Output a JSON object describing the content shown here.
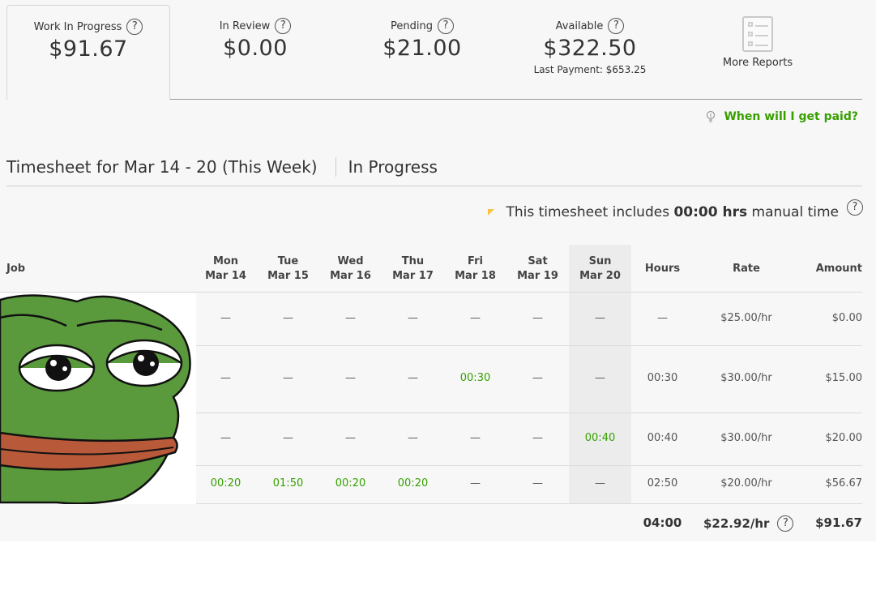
{
  "summary": {
    "work_in_progress": {
      "label": "Work In Progress",
      "amount": "$91.67"
    },
    "in_review": {
      "label": "In Review",
      "amount": "$0.00"
    },
    "pending": {
      "label": "Pending",
      "amount": "$21.00"
    },
    "available": {
      "label": "Available",
      "amount": "$322.50",
      "last_payment": "Last Payment: $653.25"
    },
    "more_reports": "More Reports",
    "help_glyph": "?"
  },
  "paid_link": "When will I get paid?",
  "timesheet": {
    "title": "Timesheet for Mar 14 - 20 (This Week)",
    "status": "In Progress",
    "manual_prefix": "This timesheet includes",
    "manual_value": "00:00 hrs",
    "manual_suffix": "manual time"
  },
  "table": {
    "job_header": "Job",
    "days": [
      {
        "day": "Mon",
        "date": "Mar 14"
      },
      {
        "day": "Tue",
        "date": "Mar 15"
      },
      {
        "day": "Wed",
        "date": "Mar 16"
      },
      {
        "day": "Thu",
        "date": "Mar 17"
      },
      {
        "day": "Fri",
        "date": "Mar 18"
      },
      {
        "day": "Sat",
        "date": "Mar 19"
      },
      {
        "day": "Sun",
        "date": "Mar 20"
      }
    ],
    "hours_header": "Hours",
    "rate_header": "Rate",
    "amount_header": "Amount",
    "rows": [
      {
        "days": [
          "—",
          "—",
          "—",
          "—",
          "—",
          "—",
          "—"
        ],
        "hours": "—",
        "rate": "$25.00/hr",
        "amount": "$0.00"
      },
      {
        "days": [
          "—",
          "—",
          "—",
          "—",
          "00:30",
          "—",
          "—"
        ],
        "hours": "00:30",
        "rate": "$30.00/hr",
        "amount": "$15.00"
      },
      {
        "days": [
          "—",
          "—",
          "—",
          "—",
          "—",
          "—",
          "00:40"
        ],
        "hours": "00:40",
        "rate": "$30.00/hr",
        "amount": "$20.00"
      },
      {
        "days": [
          "00:20",
          "01:50",
          "00:20",
          "00:20",
          "—",
          "—",
          "—"
        ],
        "hours": "02:50",
        "rate": "$20.00/hr",
        "amount": "$56.67"
      }
    ],
    "totals": {
      "hours": "04:00",
      "rate": "$22.92/hr",
      "amount": "$91.67"
    }
  },
  "colors": {
    "accent_green": "#37a000",
    "frog_green": "#5a9a3d",
    "frog_lip": "#b85a3a"
  }
}
